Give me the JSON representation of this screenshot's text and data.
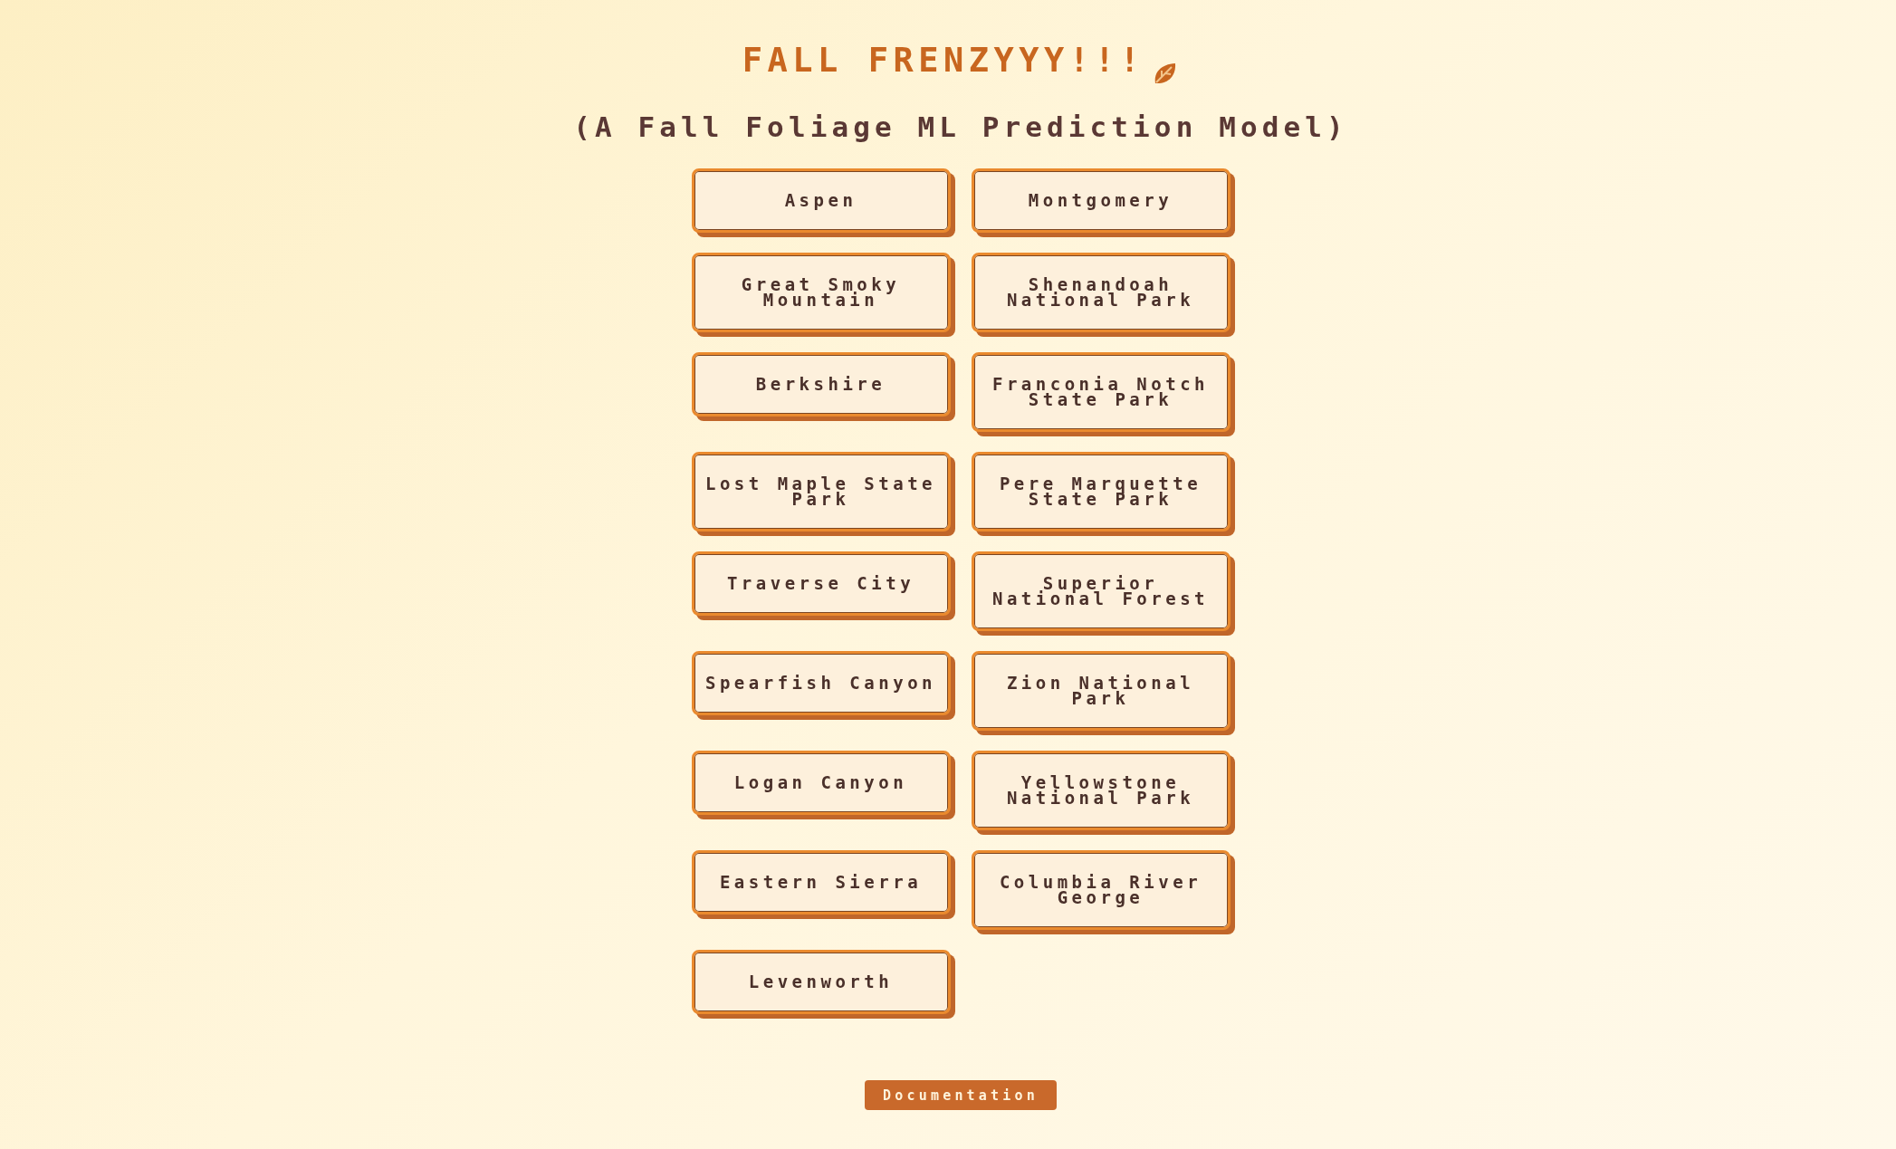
{
  "header": {
    "title": "FALL FRENZYYY!!!",
    "subtitle": "(A Fall Foliage ML Prediction Model)"
  },
  "locations": [
    "Aspen",
    "Montgomery",
    "Great Smoky Mountain",
    "Shenandoah National Park",
    "Berkshire",
    "Franconia Notch State Park",
    "Lost Maple State Park",
    "Pere Marquette State Park",
    "Traverse City",
    "Superior National Forest",
    "Spearfish Canyon",
    "Zion National Park",
    "Logan Canyon",
    "Yellowstone National Park",
    "Eastern Sierra",
    "Columbia River George",
    "Levenworth"
  ],
  "footer": {
    "documentation_button": "Documentation"
  }
}
